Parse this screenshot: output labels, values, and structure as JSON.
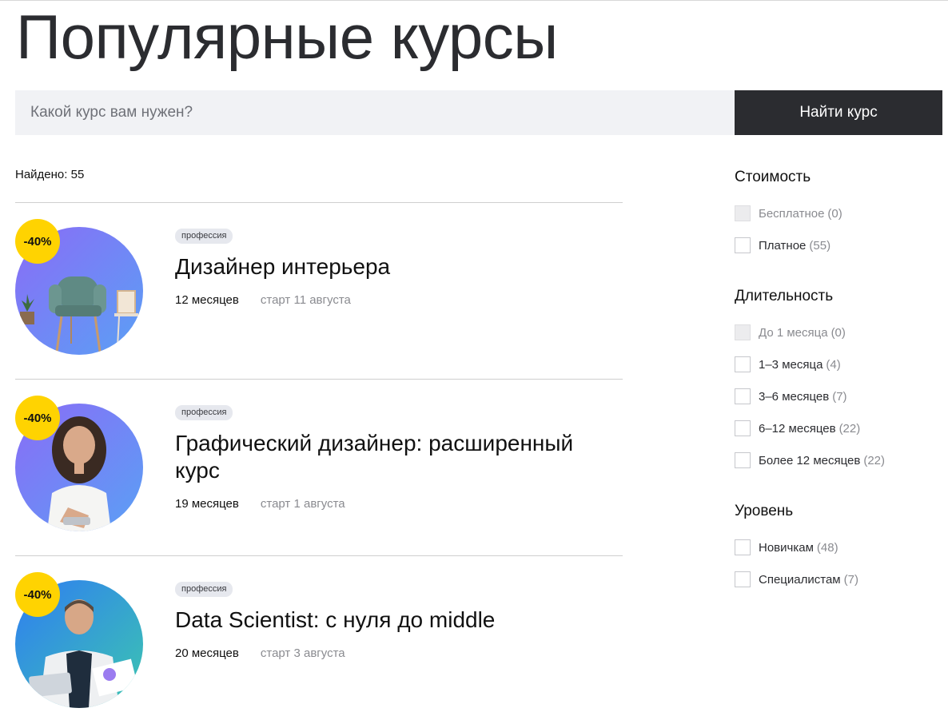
{
  "page": {
    "title": "Популярные курсы"
  },
  "search": {
    "placeholder": "Какой курс вам нужен?",
    "button_label": "Найти курс"
  },
  "results": {
    "found_label": "Найдено: 55"
  },
  "courses": [
    {
      "discount": "-40%",
      "tag": "профессия",
      "title": "Дизайнер интерьера",
      "duration": "12 месяцев",
      "start": "старт 11 августа",
      "image": "armchair-illustration"
    },
    {
      "discount": "-40%",
      "tag": "профессия",
      "title": "Графический дизайнер: расширенный курс",
      "duration": "19 месяцев",
      "start": "старт 1 августа",
      "image": "woman-with-tablet-photo"
    },
    {
      "discount": "-40%",
      "tag": "профессия",
      "title": "Data Scientist: с нуля до middle",
      "duration": "20 месяцев",
      "start": "старт 3 августа",
      "image": "man-with-tablet-photo"
    }
  ],
  "filters": [
    {
      "heading": "Стоимость",
      "options": [
        {
          "label": "Бесплатное",
          "count": "(0)",
          "disabled": true
        },
        {
          "label": "Платное",
          "count": "(55)",
          "disabled": false
        }
      ]
    },
    {
      "heading": "Длительность",
      "options": [
        {
          "label": "До 1 месяца",
          "count": "(0)",
          "disabled": true
        },
        {
          "label": "1–3 месяца",
          "count": "(4)",
          "disabled": false
        },
        {
          "label": "3–6 месяцев",
          "count": "(7)",
          "disabled": false
        },
        {
          "label": "6–12 месяцев",
          "count": "(22)",
          "disabled": false
        },
        {
          "label": "Более 12 месяцев",
          "count": "(22)",
          "disabled": false
        }
      ]
    },
    {
      "heading": "Уровень",
      "options": [
        {
          "label": "Новичкам",
          "count": "(48)",
          "disabled": false
        },
        {
          "label": "Специалистам",
          "count": "(7)",
          "disabled": false
        }
      ]
    }
  ],
  "colors": {
    "dark": "#2b2c30",
    "discount_badge": "#ffd301",
    "search_bg": "#f1f2f5",
    "muted_text": "#8a8b90"
  }
}
